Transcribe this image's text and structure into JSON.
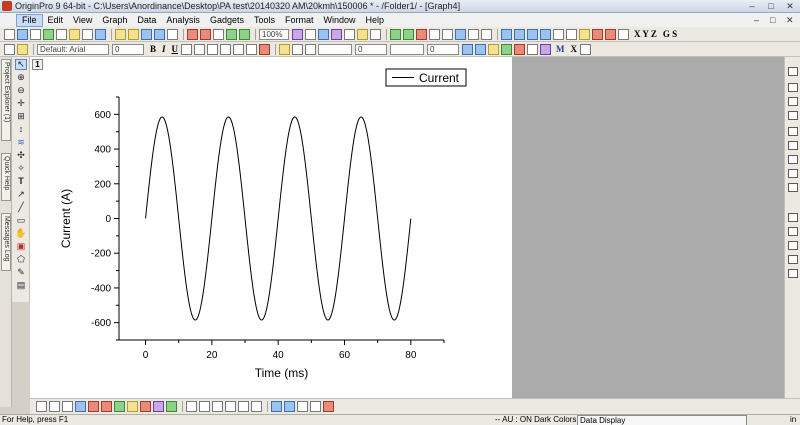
{
  "window": {
    "title": "OriginPro 9 64-bit - C:\\Users\\Anordinance\\Desktop\\PA test\\20140320 AM\\20kmh\\150006 * - /Folder1/ - [Graph4]",
    "minimize": "–",
    "restore": "□",
    "close": "✕"
  },
  "menu": {
    "items": [
      "File",
      "Edit",
      "View",
      "Graph",
      "Data",
      "Analysis",
      "Gadgets",
      "Tools",
      "Format",
      "Window",
      "Help"
    ],
    "active": "File"
  },
  "toolbar": {
    "zoom": "100%",
    "font_name": "Default: Arial",
    "font_size": "0",
    "bold": "B",
    "italic": "I",
    "underline": "U",
    "axis_letters": "X Y Z",
    "gs": "G S",
    "marker_m": "M",
    "x_label": "X"
  },
  "side_tabs": [
    "Project Explorer (1)",
    "Quick Help",
    "Messages Log"
  ],
  "graph": {
    "layer_number": "1"
  },
  "chart_data": {
    "type": "line",
    "title": "",
    "xlabel": "Time (ms)",
    "ylabel": "Current (A)",
    "xlim": [
      -8,
      90
    ],
    "ylim": [
      -700,
      700
    ],
    "xticks": [
      0,
      20,
      40,
      60,
      80
    ],
    "yticks": [
      -600,
      -400,
      -200,
      0,
      200,
      400,
      600
    ],
    "legend_position": "top-right",
    "series": [
      {
        "name": "Current",
        "amplitude": 585,
        "frequency_hz": 50,
        "x_start": 0,
        "x_end": 80,
        "color": "#000000"
      }
    ]
  },
  "status": {
    "help": "For Help, press F1",
    "au": "-- AU : ON  Dark Colors &",
    "data_display": "Data Display",
    "in": "in"
  }
}
